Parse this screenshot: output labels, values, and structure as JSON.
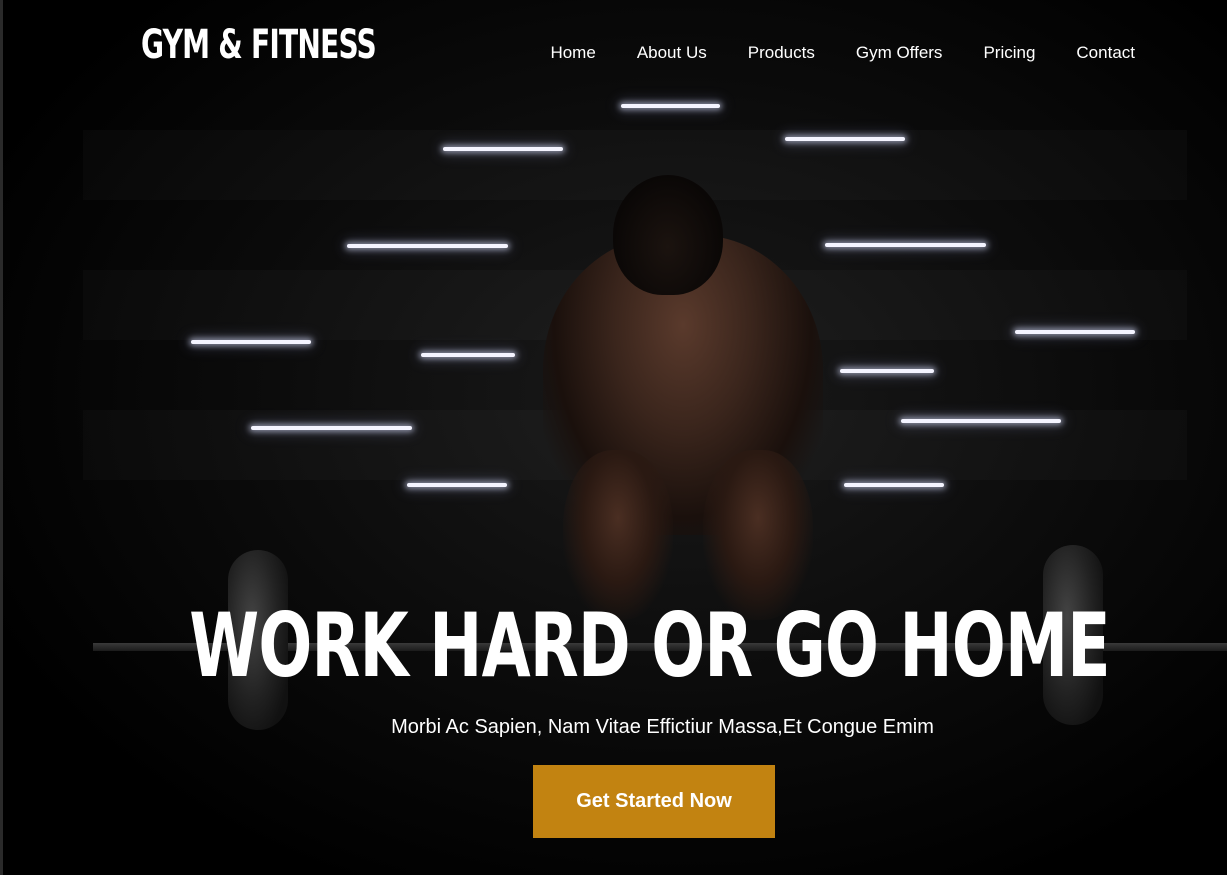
{
  "header": {
    "logo": "GYM & FITNESS",
    "nav": [
      {
        "label": "Home"
      },
      {
        "label": "About Us"
      },
      {
        "label": "Products"
      },
      {
        "label": "Gym Offers"
      },
      {
        "label": "Pricing"
      },
      {
        "label": "Contact"
      }
    ]
  },
  "hero": {
    "headline": "WORK HARD OR GO HOME",
    "subline": "Morbi Ac Sapien, Nam Vitae Effictiur Massa,Et Congue Emim",
    "cta_label": "Get Started Now"
  },
  "colors": {
    "background": "#000000",
    "accent": "#c28311",
    "text": "#ffffff"
  }
}
